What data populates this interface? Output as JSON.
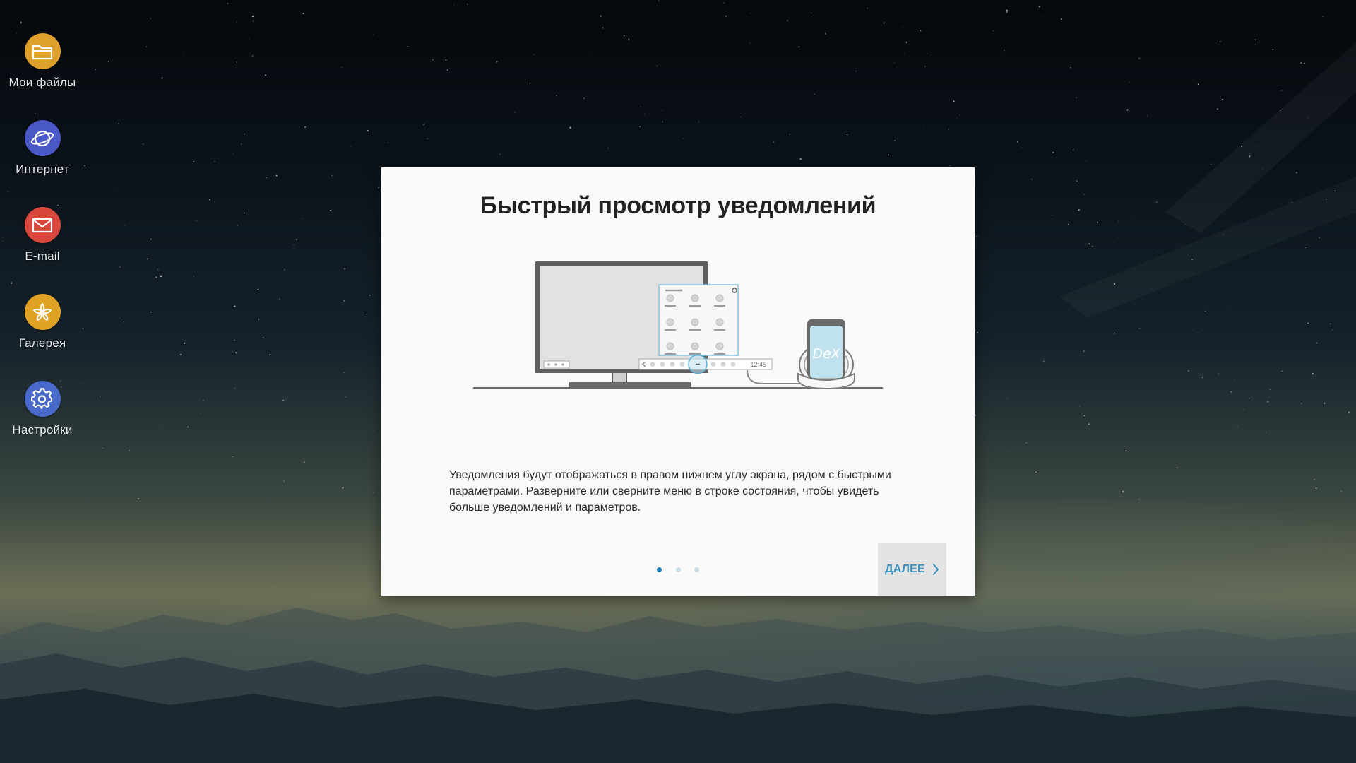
{
  "desktop": {
    "icons": [
      {
        "label": "Мои файлы",
        "icon": "folder-icon",
        "color": "#e0a02c"
      },
      {
        "label": "Интернет",
        "icon": "planet-icon",
        "color": "#4a58c8"
      },
      {
        "label": "E-mail",
        "icon": "mail-icon",
        "color": "#d8473c"
      },
      {
        "label": "Галерея",
        "icon": "flower-icon",
        "color": "#e0a224"
      },
      {
        "label": "Настройки",
        "icon": "gear-icon",
        "color": "#4a6acb"
      }
    ]
  },
  "dialog": {
    "title": "Быстрый просмотр уведомлений",
    "description": "Уведомления будут отображаться в правом нижнем углу экрана, рядом с быстрыми параметрами. Разверните или сверните меню в строке состояния, чтобы увидеть больше уведомлений и параметров.",
    "illustration": {
      "clock": "12:45",
      "phone_logo": "DeX"
    },
    "pagination": {
      "total": 3,
      "current": 1
    },
    "next_button": {
      "label": "ДАЛЕЕ",
      "icon": "chevron-right-icon",
      "color": "#3a8fbd"
    }
  }
}
